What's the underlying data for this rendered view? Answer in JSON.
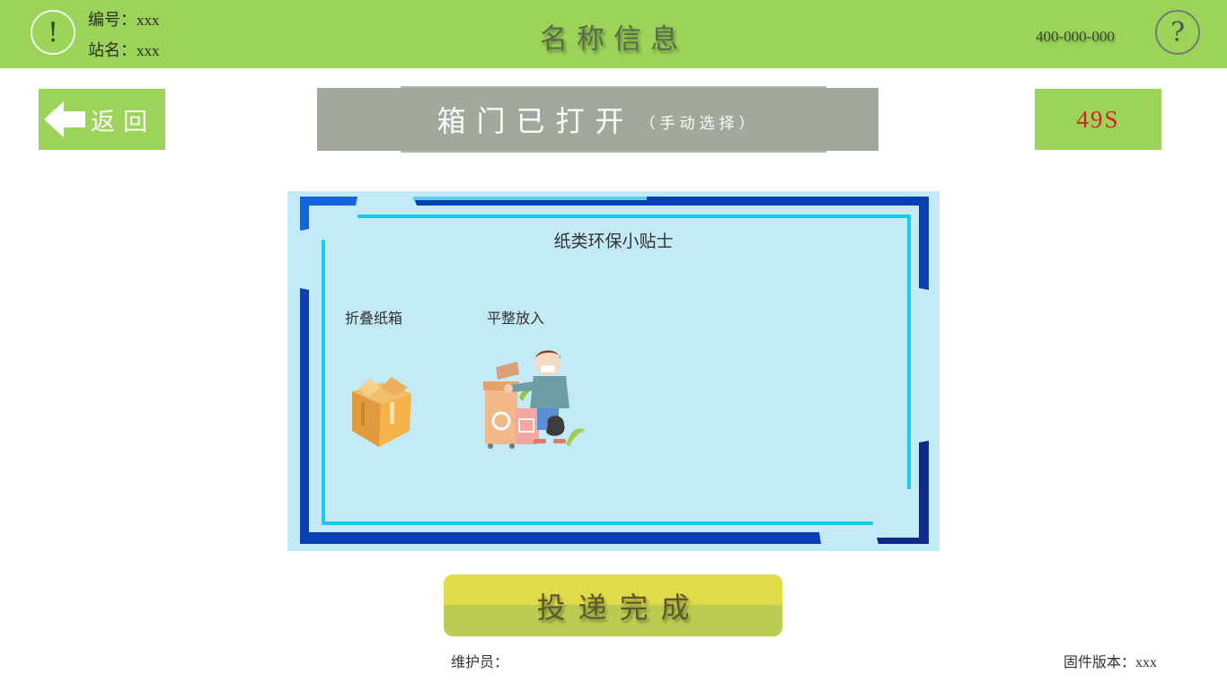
{
  "header": {
    "id_label": "编号：",
    "id_value": "xxx",
    "station_label": "站名：",
    "station_value": "xxx",
    "title": "名称信息",
    "phone": "400-000-000",
    "alert_glyph": "!",
    "help_glyph": "?"
  },
  "back_button": {
    "label": "返回",
    "icon": "arrow-left-icon"
  },
  "status_banner": {
    "text": "箱门已打开",
    "subtext": "（手动选择）"
  },
  "countdown": {
    "text": "49S"
  },
  "tips": {
    "title": "纸类环保小贴士",
    "steps": [
      {
        "label": "折叠纸箱",
        "icon": "cardboard-box-icon"
      },
      {
        "label": "平整放入",
        "icon": "person-recycling-icon"
      }
    ]
  },
  "complete_button": {
    "label": "投递完成"
  },
  "footer": {
    "maintainer_label": "维护员：",
    "firmware_label": "固件版本：",
    "firmware_value": "xxx"
  },
  "colors": {
    "brand_green": "#9bd458",
    "banner_gray": "#a2a89b",
    "countdown_red": "#d3202a",
    "card_bg": "#c2eaf7",
    "frame_blue": "#0a3fb4",
    "inner_cyan": "#1ec8ee",
    "button_yellow": "#e1db4a",
    "button_olive": "#bccb52"
  }
}
